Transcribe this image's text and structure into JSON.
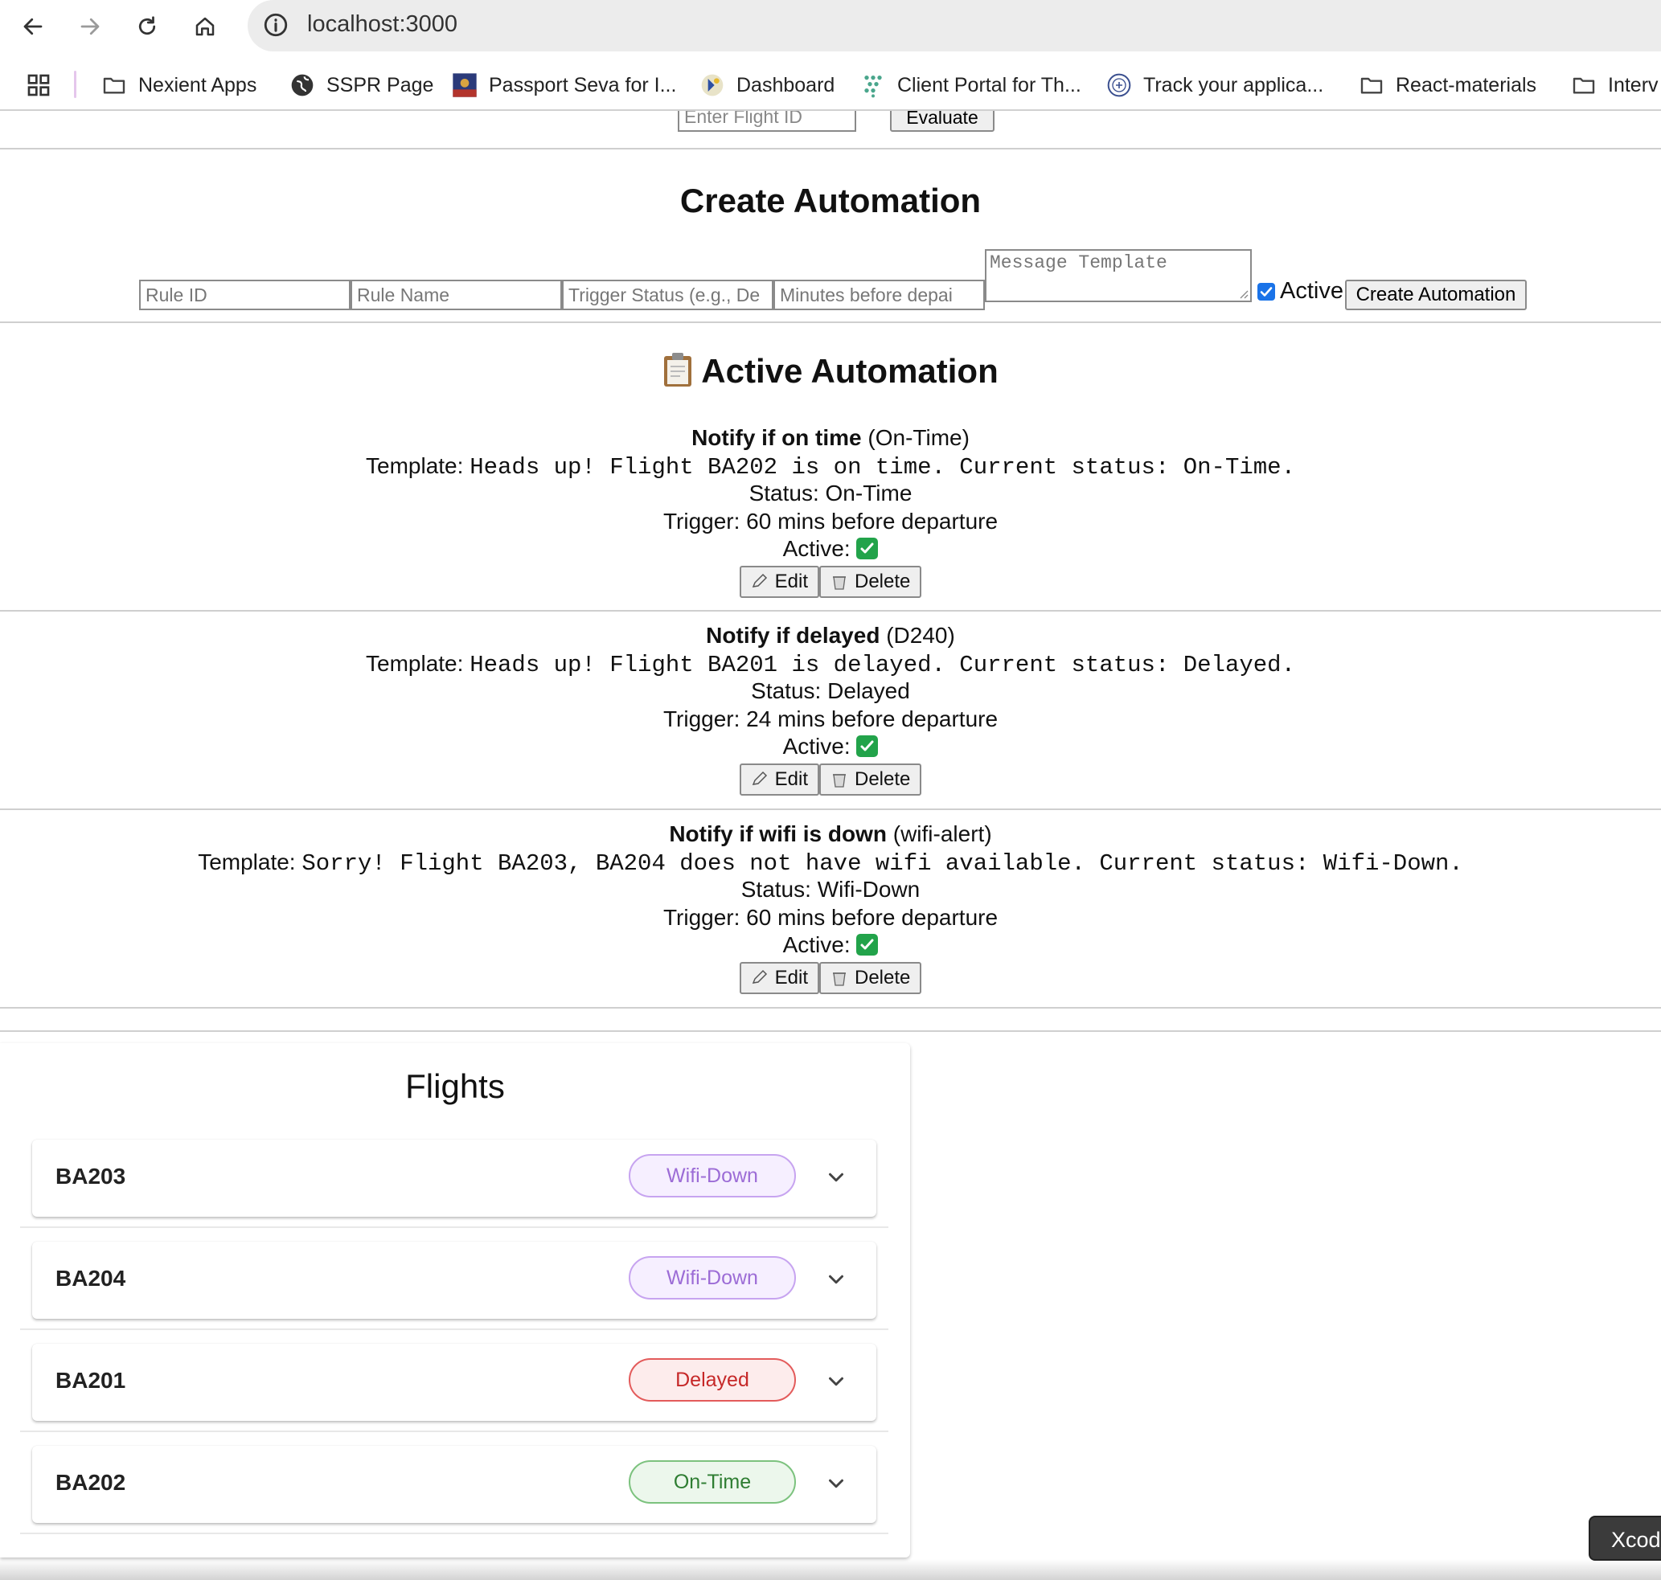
{
  "browser": {
    "url": "localhost:3000",
    "bookmarks": [
      {
        "label": "Nexient Apps",
        "icon": "folder-icon"
      },
      {
        "label": "SSPR Page",
        "icon": "globe-icon"
      },
      {
        "label": "Passport Seva for I...",
        "icon": "passport-seva-icon"
      },
      {
        "label": "Dashboard",
        "icon": "dashboard-icon"
      },
      {
        "label": "Client Portal for Th...",
        "icon": "client-portal-icon"
      },
      {
        "label": "Track your applica...",
        "icon": "track-seal-icon"
      },
      {
        "label": "React-materials",
        "icon": "folder-icon"
      },
      {
        "label": "Interv",
        "icon": "folder-icon"
      }
    ]
  },
  "evaluate": {
    "placeholder": "Enter Flight ID",
    "button_label": "Evaluate"
  },
  "create_form": {
    "heading": "Create Automation",
    "rule_id_placeholder": "Rule ID",
    "rule_name_placeholder": "Rule Name",
    "trigger_status_placeholder": "Trigger Status (e.g., De",
    "minutes_placeholder": "Minutes before depai",
    "template_placeholder": "Message Template",
    "active_label": "Active",
    "active_checked": true,
    "submit_label": "Create Automation"
  },
  "automations": {
    "heading": "Active Automation",
    "template_label": "Template:",
    "edit_label": "Edit",
    "delete_label": "Delete",
    "rules": [
      {
        "name": "Notify if on time",
        "id_text": "(On-Time)",
        "template": "Heads up! Flight BA202 is on time. Current status: On-Time.",
        "status": "Status: On-Time",
        "trigger": "Trigger: 60 mins before departure",
        "active": "Active:"
      },
      {
        "name": "Notify if delayed",
        "id_text": "(D240)",
        "template": "Heads up! Flight BA201 is delayed. Current status: Delayed.",
        "status": "Status: Delayed",
        "trigger": "Trigger: 24 mins before departure",
        "active": "Active:"
      },
      {
        "name": "Notify if wifi is down",
        "id_text": "(wifi-alert)",
        "template": "Sorry! Flight BA203, BA204 does not have wifi available. Current status: Wifi-Down.",
        "status": "Status: Wifi-Down",
        "trigger": "Trigger: 60 mins before departure",
        "active": "Active:"
      }
    ]
  },
  "flights": {
    "heading": "Flights",
    "items": [
      {
        "id": "BA203",
        "status": "Wifi-Down",
        "color": "#9c6cd6",
        "bg": "#f6efff",
        "border": "#c7a4f0"
      },
      {
        "id": "BA204",
        "status": "Wifi-Down",
        "color": "#9c6cd6",
        "bg": "#f6efff",
        "border": "#c7a4f0"
      },
      {
        "id": "BA201",
        "status": "Delayed",
        "color": "#c62828",
        "bg": "#fdecec",
        "border": "#e35b5b"
      },
      {
        "id": "BA202",
        "status": "On-Time",
        "color": "#2e7d32",
        "bg": "#ecf7ec",
        "border": "#7cc27e"
      }
    ]
  },
  "overlay": {
    "xcode_tip": "Xcod"
  }
}
